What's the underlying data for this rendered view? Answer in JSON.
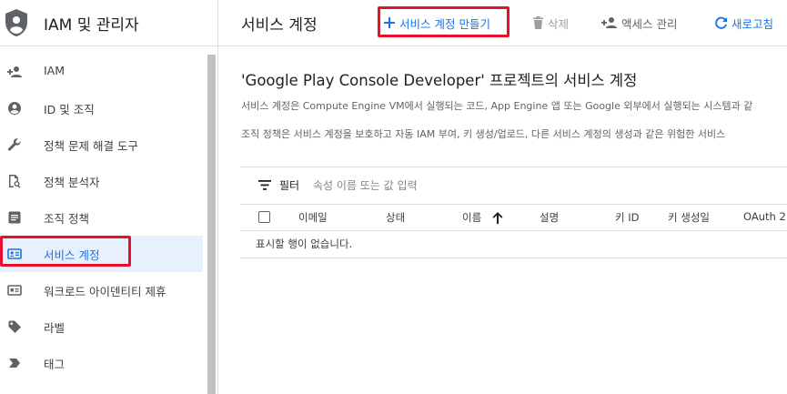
{
  "sidebar": {
    "title": "IAM 및 관리자",
    "items": [
      {
        "label": "IAM",
        "icon": "person-add-icon"
      },
      {
        "label": "ID 및 조직",
        "icon": "account-circle-icon"
      },
      {
        "label": "정책 문제 해결 도구",
        "icon": "wrench-icon"
      },
      {
        "label": "정책 분석자",
        "icon": "document-search-icon"
      },
      {
        "label": "조직 정책",
        "icon": "list-article-icon"
      },
      {
        "label": "서비스 계정",
        "icon": "service-account-icon",
        "active": true
      },
      {
        "label": "워크로드 아이덴티티 제휴",
        "icon": "id-card-icon"
      },
      {
        "label": "라벨",
        "icon": "label-tag-icon"
      },
      {
        "label": "태그",
        "icon": "chevron-tag-icon"
      }
    ]
  },
  "header": {
    "page_title": "서비스 계정",
    "create_label": "서비스 계정 만들기",
    "delete_label": "삭제",
    "manage_access_label": "액세스 관리",
    "refresh_label": "새로고침"
  },
  "main": {
    "heading": "'Google Play Console Developer' 프로젝트의 서비스 계정",
    "description_1": "서비스 계정은 Compute Engine VM에서 실행되는 코드, App Engine 앱 또는 Google 외부에서 실행되는 시스템과 같",
    "description_2": "조직 정책은 서비스 계정을 보호하고 자동 IAM 부여, 키 생성/업로드, 다른 서비스 계정의 생성과 같은 위험한 서비스",
    "filter_label": "필터",
    "filter_placeholder": "속성 이름 또는 값 입력",
    "columns": [
      "이메일",
      "상태",
      "이름",
      "설명",
      "키 ID",
      "키 생성일",
      "OAuth 2"
    ],
    "empty_message": "표시할 행이 없습니다."
  },
  "colors": {
    "accent": "#1a73e8",
    "highlight_box": "#e8112d",
    "active_background": "#e8f0fe"
  }
}
